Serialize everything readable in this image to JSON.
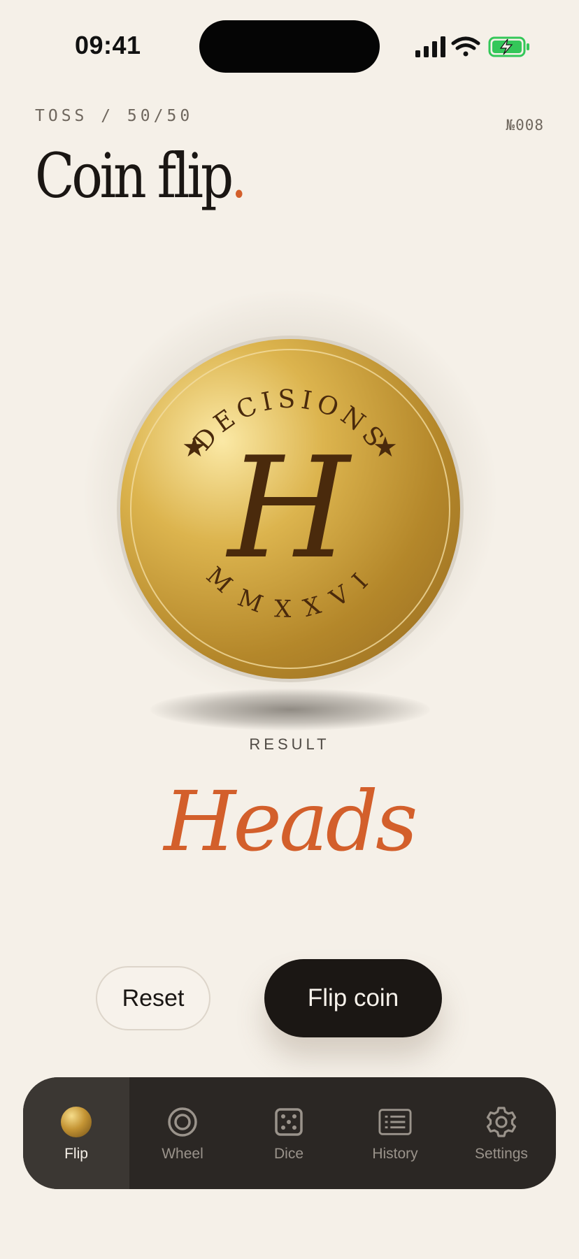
{
  "status_bar": {
    "time": "09:41"
  },
  "header": {
    "eyebrow": "TOSS / 50/50",
    "issue": "№008",
    "title": "Coin flip",
    "title_dot": "."
  },
  "coin": {
    "top_text": "DECISIONS",
    "letter": "H",
    "bottom_text": "MMXXVI",
    "star": "★",
    "colors": {
      "gold_light": "#f7e49a",
      "gold": "#d4a63b",
      "gold_dark": "#a87a22",
      "ink": "#4a2a0c"
    }
  },
  "result": {
    "label": "RESULT",
    "value": "Heads"
  },
  "actions": {
    "reset_label": "Reset",
    "flip_label": "Flip coin"
  },
  "tabbar": {
    "items": [
      {
        "label": "Flip",
        "icon": "coin-icon",
        "active": true
      },
      {
        "label": "Wheel",
        "icon": "wheel-icon",
        "active": false
      },
      {
        "label": "Dice",
        "icon": "dice-icon",
        "active": false
      },
      {
        "label": "History",
        "icon": "history-list-icon",
        "active": false
      },
      {
        "label": "Settings",
        "icon": "gear-icon",
        "active": false
      }
    ]
  },
  "colors": {
    "accent": "#d35f2b",
    "background": "#f5f0e8",
    "dark": "#1b1714"
  }
}
